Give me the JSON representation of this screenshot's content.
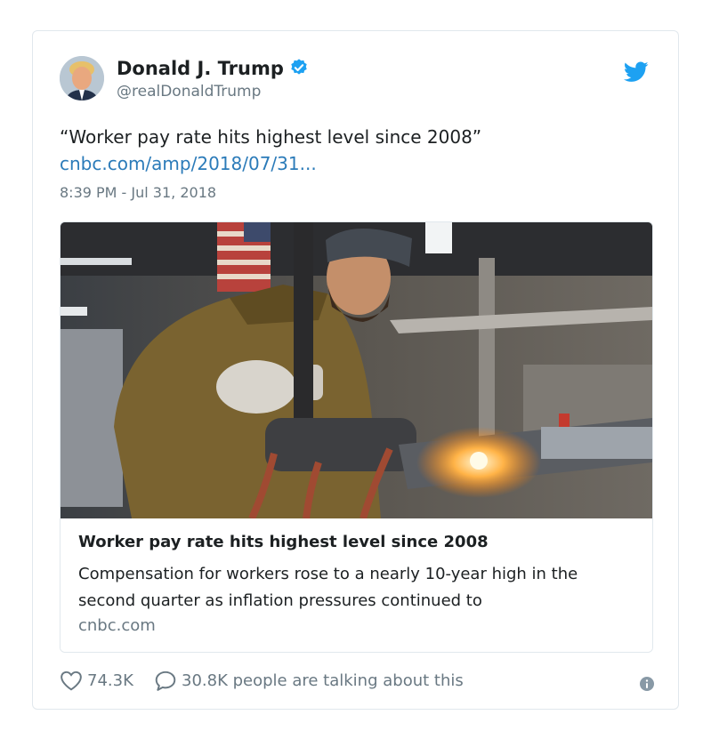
{
  "tweet": {
    "author": {
      "name": "Donald J. Trump",
      "handle": "@realDonaldTrump",
      "verified": true
    },
    "text": "“Worker pay rate hits highest level since 2008”",
    "link": "cnbc.com/amp/2018/07/31...",
    "timestamp": "8:39 PM - Jul 31, 2018"
  },
  "card": {
    "title": "Worker pay rate hits highest level since 2008",
    "description": "Compensation for workers rose to a nearly 10-year high in the second quarter as inflation pressures continued to",
    "domain": "cnbc.com"
  },
  "actions": {
    "likes": "74.3K",
    "talking": "30.8K people are talking about this"
  },
  "icons": {
    "brand": "twitter-bird-icon",
    "verified": "verified-badge-icon",
    "like": "heart-icon",
    "reply": "speech-bubble-icon",
    "info": "info-icon"
  },
  "colors": {
    "brand_blue": "#1da1f2",
    "link": "#2b7bb9",
    "muted": "#697882",
    "text": "#1c2022",
    "border": "#e1e8ed"
  }
}
